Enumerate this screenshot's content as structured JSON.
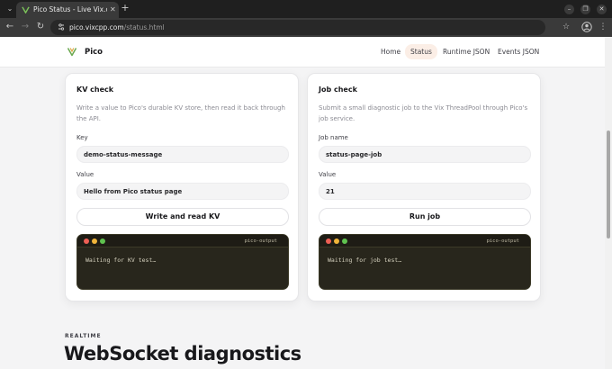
{
  "browser": {
    "tab_title": "Pico Status - Live Vix.cpp",
    "url_host": "pico.vixcpp.com",
    "url_path": "/status.html"
  },
  "site": {
    "brand": "Pico",
    "nav": [
      "Home",
      "Status",
      "Runtime JSON",
      "Events JSON"
    ],
    "active_nav": "Status",
    "accent_color": "#6aa84f"
  },
  "kv_card": {
    "title": "KV check",
    "description": "Write a value to Pico's durable KV store, then read it back through the API.",
    "key_label": "Key",
    "key_value": "demo-status-message",
    "value_label": "Value",
    "value_value": "Hello from Pico status page",
    "button": "Write and read KV",
    "terminal_name": "pico-output",
    "terminal_text": "Waiting for KV test…"
  },
  "job_card": {
    "title": "Job check",
    "description": "Submit a small diagnostic job to the Vix ThreadPool through Pico's job service.",
    "name_label": "Job name",
    "name_value": "status-page-job",
    "value_label": "Value",
    "value_value": "21",
    "button": "Run job",
    "terminal_name": "pico-output",
    "terminal_text": "Waiting for job test…"
  },
  "section": {
    "kicker": "REALTIME",
    "title": "WebSocket diagnostics"
  }
}
